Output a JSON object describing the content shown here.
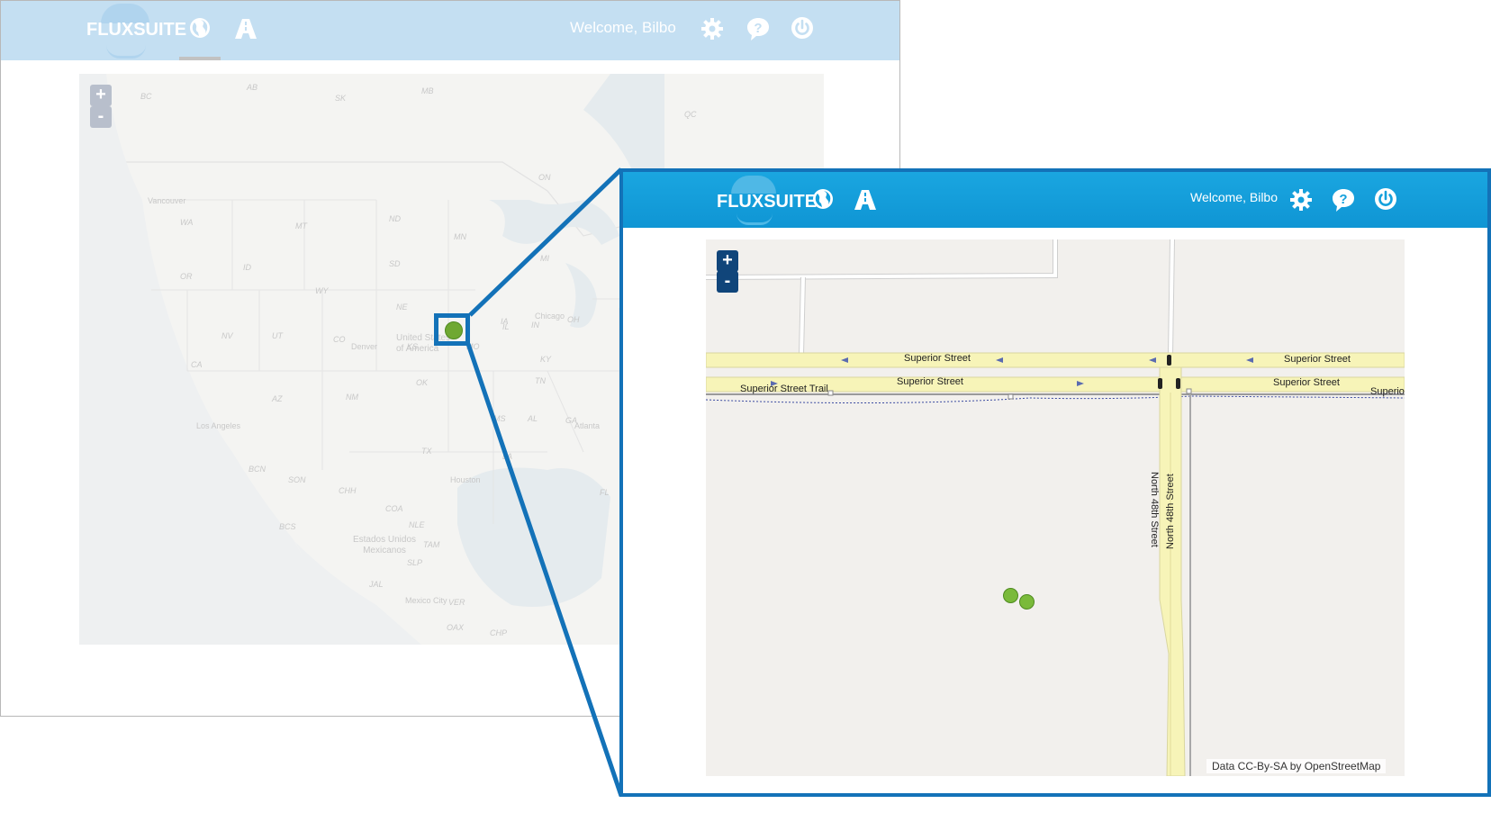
{
  "app": {
    "logo_text": "FLUXSUITE",
    "welcome_text": "Welcome, Bilbo"
  },
  "icons": {
    "nav": [
      "globe-icon",
      "road-icon"
    ],
    "header_right": [
      "gear-icon",
      "help-icon",
      "power-icon"
    ]
  },
  "map_controls": {
    "zoom_in": "+",
    "zoom_out": "-"
  },
  "overview_map": {
    "state_labels": [
      "BC",
      "AB",
      "SK",
      "MB",
      "ON",
      "QC",
      "WA",
      "MT",
      "ND",
      "MN",
      "OR",
      "ID",
      "SD",
      "WY",
      "MI",
      "NE",
      "NV",
      "UT",
      "CO",
      "IA",
      "IL",
      "IN",
      "OH",
      "KS",
      "MO",
      "KY",
      "CA",
      "AZ",
      "NM",
      "OK",
      "TN",
      "AL",
      "GA",
      "MS",
      "TX",
      "LA",
      "BCN",
      "SON",
      "CHH",
      "COA",
      "NLE",
      "TAM",
      "BCS",
      "SLP",
      "JAL",
      "VER",
      "OAX",
      "CHP",
      "FL"
    ],
    "city_labels": [
      "Vancouver",
      "Denver",
      "Chicago",
      "Los Angeles",
      "Atlanta",
      "Houston",
      "Mexico City"
    ],
    "country_labels": [
      "United States of America",
      "Estados Unidos Mexicanos"
    ]
  },
  "detail_map": {
    "streets": {
      "superior_street": "Superior Street",
      "superior_street_trail": "Superior Street Trail",
      "superior_cut": "Superio",
      "north_48th": "North 48th Street"
    },
    "attribution": "Data CC-By-SA by OpenStreetMap"
  },
  "colors": {
    "bg_header": "#c4dff2",
    "fg_header": "#1aa6e0",
    "callout": "#1372b8",
    "marker": "#7aba3a",
    "zoom_button": "#10457a"
  }
}
